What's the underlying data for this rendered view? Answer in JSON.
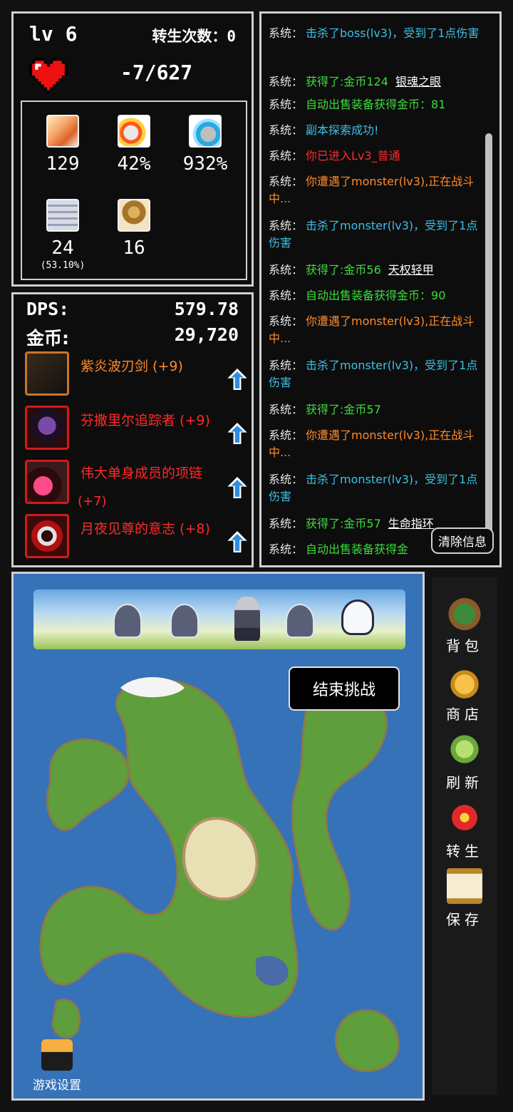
{
  "player": {
    "level": "lv 6",
    "rebirth_label": "转生次数：",
    "rebirth_count": "0",
    "hp": "-7/627"
  },
  "stats": [
    {
      "icon": "sword-icon",
      "value": "129",
      "sub": ""
    },
    {
      "icon": "crit-rate-icon",
      "value": "42%",
      "sub": ""
    },
    {
      "icon": "crit-damage-icon",
      "value": "932%",
      "sub": ""
    },
    {
      "icon": "shield-icon",
      "value": "24",
      "sub": "(53.10%)"
    },
    {
      "icon": "armor-icon",
      "value": "16",
      "sub": ""
    }
  ],
  "summary": {
    "dps_label": "DPS:",
    "dps_value": "579.78",
    "gold_label": "金币:",
    "gold_value": "29,720"
  },
  "equipment": [
    {
      "name": "紫炎波刃剑 (+9)",
      "color": "#ff8a2a",
      "icon": "sword-item-icon"
    },
    {
      "name": "芬撒里尔追踪者 (+9)",
      "color": "#ff2a2a",
      "icon": "hunter-item-icon"
    },
    {
      "name": "伟大单身成员的项链",
      "name2": "(+7)",
      "color": "#ff2a2a",
      "icon": "necklace-item-icon"
    },
    {
      "name": "月夜见尊的意志 (+8)",
      "color": "#ff2a2a",
      "icon": "ring-item-icon"
    }
  ],
  "log": {
    "sys_label": "系统：",
    "entries": [
      {
        "text": "击杀了boss(lv3)，受到了1点伤害",
        "color": "#3cc0e6",
        "link": ""
      },
      {
        "text": "获得了:金币124",
        "color": "#3cdc3c",
        "link": "银魂之眼"
      },
      {
        "text": "自动出售装备获得金币：81",
        "color": "#3cdc3c",
        "link": ""
      },
      {
        "text": "副本探索成功!",
        "color": "#3cc0e6",
        "link": ""
      },
      {
        "text": "你已进入Lv3_普通",
        "color": "#ff2a2a",
        "link": ""
      },
      {
        "text": "你遭遇了monster(lv3),正在战斗中...",
        "color": "#ff8a2a",
        "link": ""
      },
      {
        "text": "击杀了monster(lv3)，受到了1点伤害",
        "color": "#3cc0e6",
        "link": ""
      },
      {
        "text": "获得了:金币56",
        "color": "#3cdc3c",
        "link": "天权轻甲"
      },
      {
        "text": "自动出售装备获得金币：90",
        "color": "#3cdc3c",
        "link": ""
      },
      {
        "text": "你遭遇了monster(lv3),正在战斗中...",
        "color": "#ff8a2a",
        "link": ""
      },
      {
        "text": "击杀了monster(lv3)，受到了1点伤害",
        "color": "#3cc0e6",
        "link": ""
      },
      {
        "text": "获得了:金币57",
        "color": "#3cdc3c",
        "link": ""
      },
      {
        "text": "你遭遇了monster(lv3),正在战斗中...",
        "color": "#ff8a2a",
        "link": ""
      },
      {
        "text": "击杀了monster(lv3)，受到了1点伤害",
        "color": "#3cc0e6",
        "link": ""
      },
      {
        "text": "获得了:金币57",
        "color": "#3cdc3c",
        "link": "生命指环"
      },
      {
        "text": "自动出售装备获得金",
        "color": "#3cdc3c",
        "link": ""
      }
    ],
    "clear_label": "清除信息"
  },
  "map": {
    "end_challenge": "结束挑战",
    "settings_label": "游戏设置"
  },
  "menu": [
    {
      "label": "背包",
      "icon": "backpack-icon"
    },
    {
      "label": "商店",
      "icon": "coins-icon"
    },
    {
      "label": "刷新",
      "icon": "scroll-refresh-icon"
    },
    {
      "label": "转生",
      "icon": "rebirth-icon"
    },
    {
      "label": "保存",
      "icon": "save-scroll-icon"
    }
  ],
  "colors": {
    "orange": "#ff8a2a",
    "red": "#ff2a2a",
    "cyan": "#3cc0e6",
    "green": "#3cdc3c"
  }
}
